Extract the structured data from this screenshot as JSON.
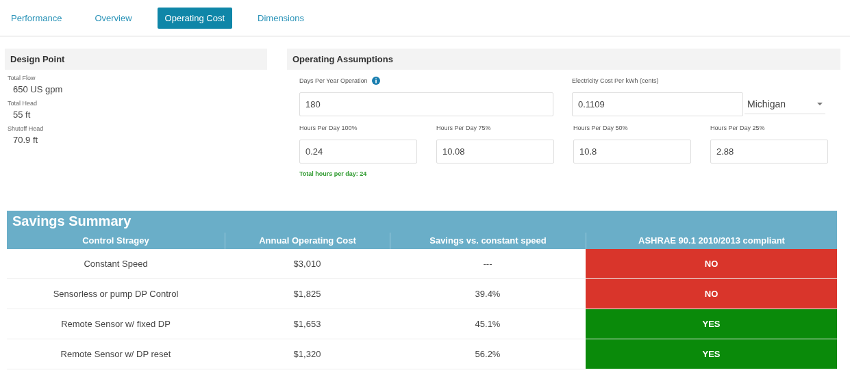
{
  "tabs": [
    {
      "label": "Performance",
      "selected": false
    },
    {
      "label": "Overview",
      "selected": false
    },
    {
      "label": "Operating Cost",
      "selected": true
    },
    {
      "label": "Dimensions",
      "selected": false
    }
  ],
  "design_point": {
    "title": "Design Point",
    "items": [
      {
        "label": "Total Flow",
        "value": "650 US gpm"
      },
      {
        "label": "Total Head",
        "value": "55 ft"
      },
      {
        "label": "Shutoff Head",
        "value": "70.9 ft"
      }
    ]
  },
  "operating_assumptions": {
    "title": "Operating Assumptions",
    "days": {
      "label": "Days Per Year Operation",
      "value": "180"
    },
    "electricity": {
      "label": "Electricity Cost Per kWh (cents)",
      "value": "0.1109"
    },
    "state_select": {
      "value": "Michigan"
    },
    "hours": [
      {
        "label": "Hours Per Day 100%",
        "value": "0.24"
      },
      {
        "label": "Hours Per Day 75%",
        "value": "10.08"
      },
      {
        "label": "Hours Per Day 50%",
        "value": "10.8"
      },
      {
        "label": "Hours Per Day 25%",
        "value": "2.88"
      }
    ],
    "total_note": "Total hours per day: 24"
  },
  "savings_summary": {
    "title": "Savings Summary",
    "columns": [
      "Control Stragey",
      "Annual Operating Cost",
      "Savings vs. constant speed",
      "ASHRAE 90.1 2010/2013 compliant"
    ],
    "rows": [
      {
        "strategy": "Constant Speed",
        "cost": "$3,010",
        "savings": "---",
        "compliant": false,
        "compliance": "NO"
      },
      {
        "strategy": "Sensorless or pump DP Control",
        "cost": "$1,825",
        "savings": "39.4%",
        "compliant": false,
        "compliance": "NO"
      },
      {
        "strategy": "Remote Sensor w/ fixed DP",
        "cost": "$1,653",
        "savings": "45.1%",
        "compliant": true,
        "compliance": "YES"
      },
      {
        "strategy": "Remote Sensor w/ DP reset",
        "cost": "$1,320",
        "savings": "56.2%",
        "compliant": true,
        "compliance": "YES"
      }
    ]
  }
}
